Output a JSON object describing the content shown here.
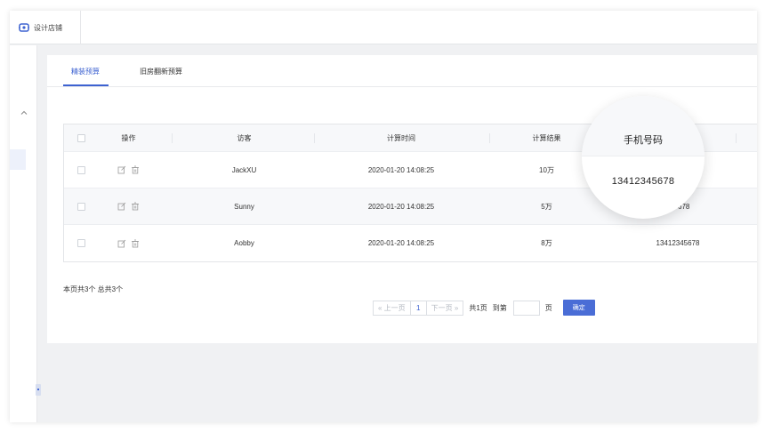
{
  "header": {
    "brand": "设计店铺",
    "brand_icon": "store-icon"
  },
  "tabs": [
    {
      "label": "精装预算",
      "active": true
    },
    {
      "label": "旧房翻新预算",
      "active": false
    }
  ],
  "table": {
    "headers": {
      "select": "",
      "actions": "操作",
      "visitor": "访客",
      "time": "计算时间",
      "result": "计算结果",
      "phone": "手机号码"
    },
    "rows": [
      {
        "visitor": "JackXU",
        "time": "2020-01-20 14:08:25",
        "result": "10万",
        "phone": "13412345678"
      },
      {
        "visitor": "Sunny",
        "time": "2020-01-20 14:08:25",
        "result": "5万",
        "phone": "13412345678"
      },
      {
        "visitor": "Aobby",
        "time": "2020-01-20 14:08:25",
        "result": "8万",
        "phone": "13412345678"
      }
    ],
    "phone_visible_fragment_row2": "678"
  },
  "summary": "本页共3个 总共3个",
  "pagination": {
    "prev": "« 上一页",
    "current_page": "1",
    "next": "下一页 »",
    "total": "共1页",
    "goto": "到第",
    "page_unit": "页",
    "confirm": "确定"
  },
  "magnifier": {
    "title": "手机号码",
    "value": "13412345678"
  },
  "colors": {
    "accent": "#3d62d1",
    "button": "#4a6dd6",
    "background": "#f0f1f3"
  }
}
